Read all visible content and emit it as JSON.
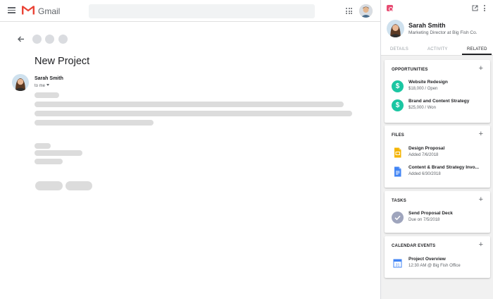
{
  "gmail": {
    "app_name": "Gmail",
    "subject": "New Project",
    "sender_name": "Sarah Smith",
    "recipient": "to me"
  },
  "sidebar": {
    "contact": {
      "name": "Sarah Smith",
      "title": "Marketing Director at Big Fish Co."
    },
    "tabs": [
      {
        "label": "DETAILS",
        "active": false
      },
      {
        "label": "ACTIVITY",
        "active": false
      },
      {
        "label": "RELATED",
        "active": true
      }
    ],
    "sections": {
      "opportunities": {
        "title": "OPPORTUNITIES",
        "items": [
          {
            "name": "Website Redesign",
            "sub": "$18,000 / Open",
            "icon": "dollar-icon"
          },
          {
            "name": "Brand and Content Strategy",
            "sub": "$25,000 / Won",
            "icon": "dollar-icon"
          }
        ]
      },
      "files": {
        "title": "FILES",
        "items": [
          {
            "name": "Design Proposal",
            "sub": "Added 7/6/2018",
            "icon": "google-slides-icon"
          },
          {
            "name": "Content & Brand Strategy Invo...",
            "sub": "Added 6/30/2018",
            "icon": "google-docs-icon"
          }
        ]
      },
      "tasks": {
        "title": "TASKS",
        "items": [
          {
            "name": "Send Proposal Deck",
            "sub": "Due on 7/5/2018",
            "icon": "completed-check-icon"
          }
        ]
      },
      "calendar": {
        "title": "CALENDAR EVENTS",
        "items": [
          {
            "name": "Project Overview",
            "sub": "12:30 AM @ Big Fish Office",
            "icon": "google-calendar-icon",
            "day": "31"
          }
        ]
      }
    }
  },
  "colors": {
    "gmail_red": "#ea4335",
    "opportunity_green": "#1bc6a2",
    "slides_yellow": "#f4b400",
    "docs_blue": "#4285f4",
    "task_check": "#9fa5bd",
    "brand_pink": "#e74c72"
  }
}
